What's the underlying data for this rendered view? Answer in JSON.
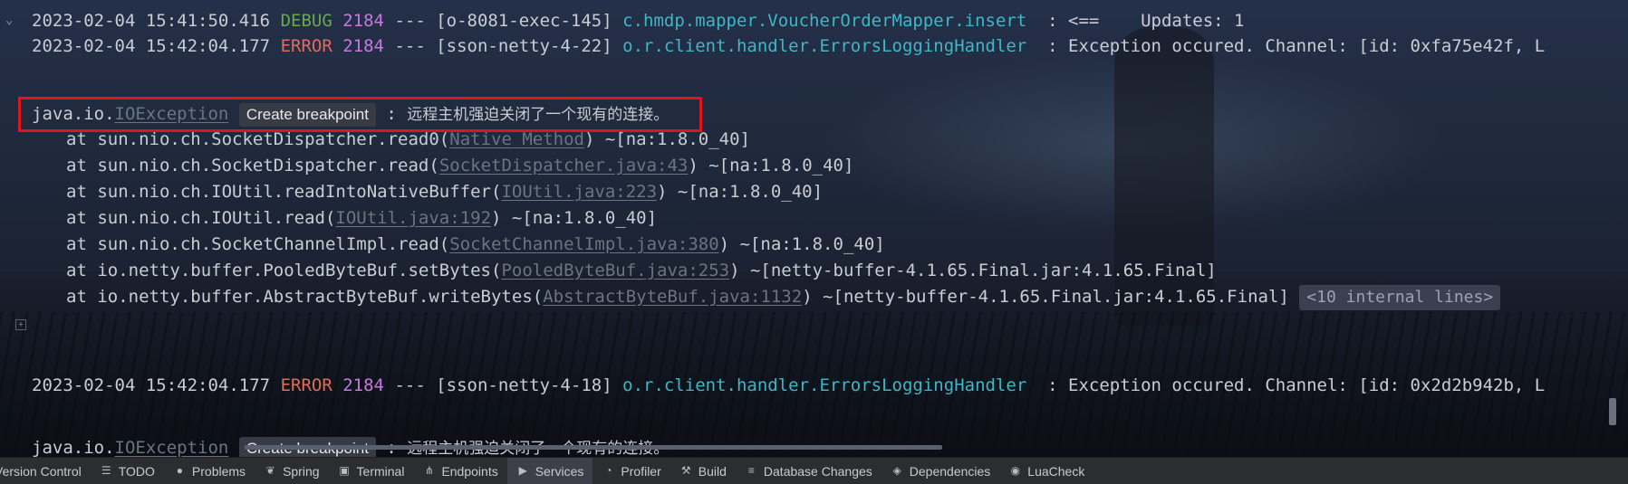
{
  "log": {
    "line1": {
      "timestamp": "2023-02-04 15:41:50.416",
      "level": "DEBUG",
      "pid": "2184",
      "sep": "---",
      "thread": "[o-8081-exec-145]",
      "logger": "c.hmdp.mapper.VoucherOrderMapper.insert",
      "message": "  : <==    Updates: 1"
    },
    "line2": {
      "timestamp": "2023-02-04 15:42:04.177",
      "level": "ERROR",
      "pid": "2184",
      "sep": "---",
      "thread": "[sson-netty-4-22]",
      "logger": "o.r.client.handler.ErrorsLoggingHandler",
      "message": "  : Exception occured. Channel: [id: 0xfa75e42f, L"
    },
    "exception": {
      "pkg": "java.io.",
      "cls": "IOException",
      "hint": "Create breakpoint",
      "colon": " : ",
      "msg": "远程主机强迫关闭了一个现有的连接。"
    },
    "frames": [
      {
        "method": "at sun.nio.ch.SocketDispatcher.read0(",
        "src": "Native Method",
        "tail": ") ~[na:1.8.0_40]"
      },
      {
        "method": "at sun.nio.ch.SocketDispatcher.read(",
        "src": "SocketDispatcher.java:43",
        "tail": ") ~[na:1.8.0_40]"
      },
      {
        "method": "at sun.nio.ch.IOUtil.readIntoNativeBuffer(",
        "src": "IOUtil.java:223",
        "tail": ") ~[na:1.8.0_40]"
      },
      {
        "method": "at sun.nio.ch.IOUtil.read(",
        "src": "IOUtil.java:192",
        "tail": ") ~[na:1.8.0_40]"
      },
      {
        "method": "at sun.nio.ch.SocketChannelImpl.read(",
        "src": "SocketChannelImpl.java:380",
        "tail": ") ~[na:1.8.0_40]"
      },
      {
        "method": "at io.netty.buffer.PooledByteBuf.setBytes(",
        "src": "PooledByteBuf.java:253",
        "tail": ") ~[netty-buffer-4.1.65.Final.jar:4.1.65.Final]"
      },
      {
        "method": "at io.netty.buffer.AbstractByteBuf.writeBytes(",
        "src": "AbstractByteBuf.java:1132",
        "tail": ") ~[netty-buffer-4.1.65.Final.jar:4.1.65.Final]"
      }
    ],
    "internal_lines": "<10 internal lines>",
    "line3": {
      "timestamp": "2023-02-04 15:42:04.177",
      "level": "ERROR",
      "pid": "2184",
      "sep": "---",
      "thread": "[sson-netty-4-18]",
      "logger": "o.r.client.handler.ErrorsLoggingHandler",
      "message": "  : Exception occured. Channel: [id: 0x2d2b942b, L"
    },
    "exception2": {
      "pkg": "java.io.",
      "cls": "IOException",
      "hint": "Create breakpoint",
      "colon": " : ",
      "msg": "远程主机强迫关闭了一个现有的连接。"
    }
  },
  "toolbar": {
    "items": [
      {
        "label": "Version Control",
        "icon": "version-control-icon"
      },
      {
        "label": "TODO",
        "icon": "list-icon"
      },
      {
        "label": "Problems",
        "icon": "info-icon"
      },
      {
        "label": "Spring",
        "icon": "leaf-icon"
      },
      {
        "label": "Terminal",
        "icon": "terminal-icon"
      },
      {
        "label": "Endpoints",
        "icon": "endpoints-icon"
      },
      {
        "label": "Services",
        "icon": "services-icon"
      },
      {
        "label": "Profiler",
        "icon": "profiler-icon"
      },
      {
        "label": "Build",
        "icon": "hammer-icon"
      },
      {
        "label": "Database Changes",
        "icon": "database-icon"
      },
      {
        "label": "Dependencies",
        "icon": "layers-icon"
      },
      {
        "label": "LuaCheck",
        "icon": "luacheck-icon"
      }
    ],
    "active": "Services"
  },
  "colors": {
    "error": "#e06c5a",
    "debug": "#6aa84f",
    "pid": "#c679dd",
    "logger": "#3fb6c6",
    "highlight_box": "#e0141b"
  }
}
